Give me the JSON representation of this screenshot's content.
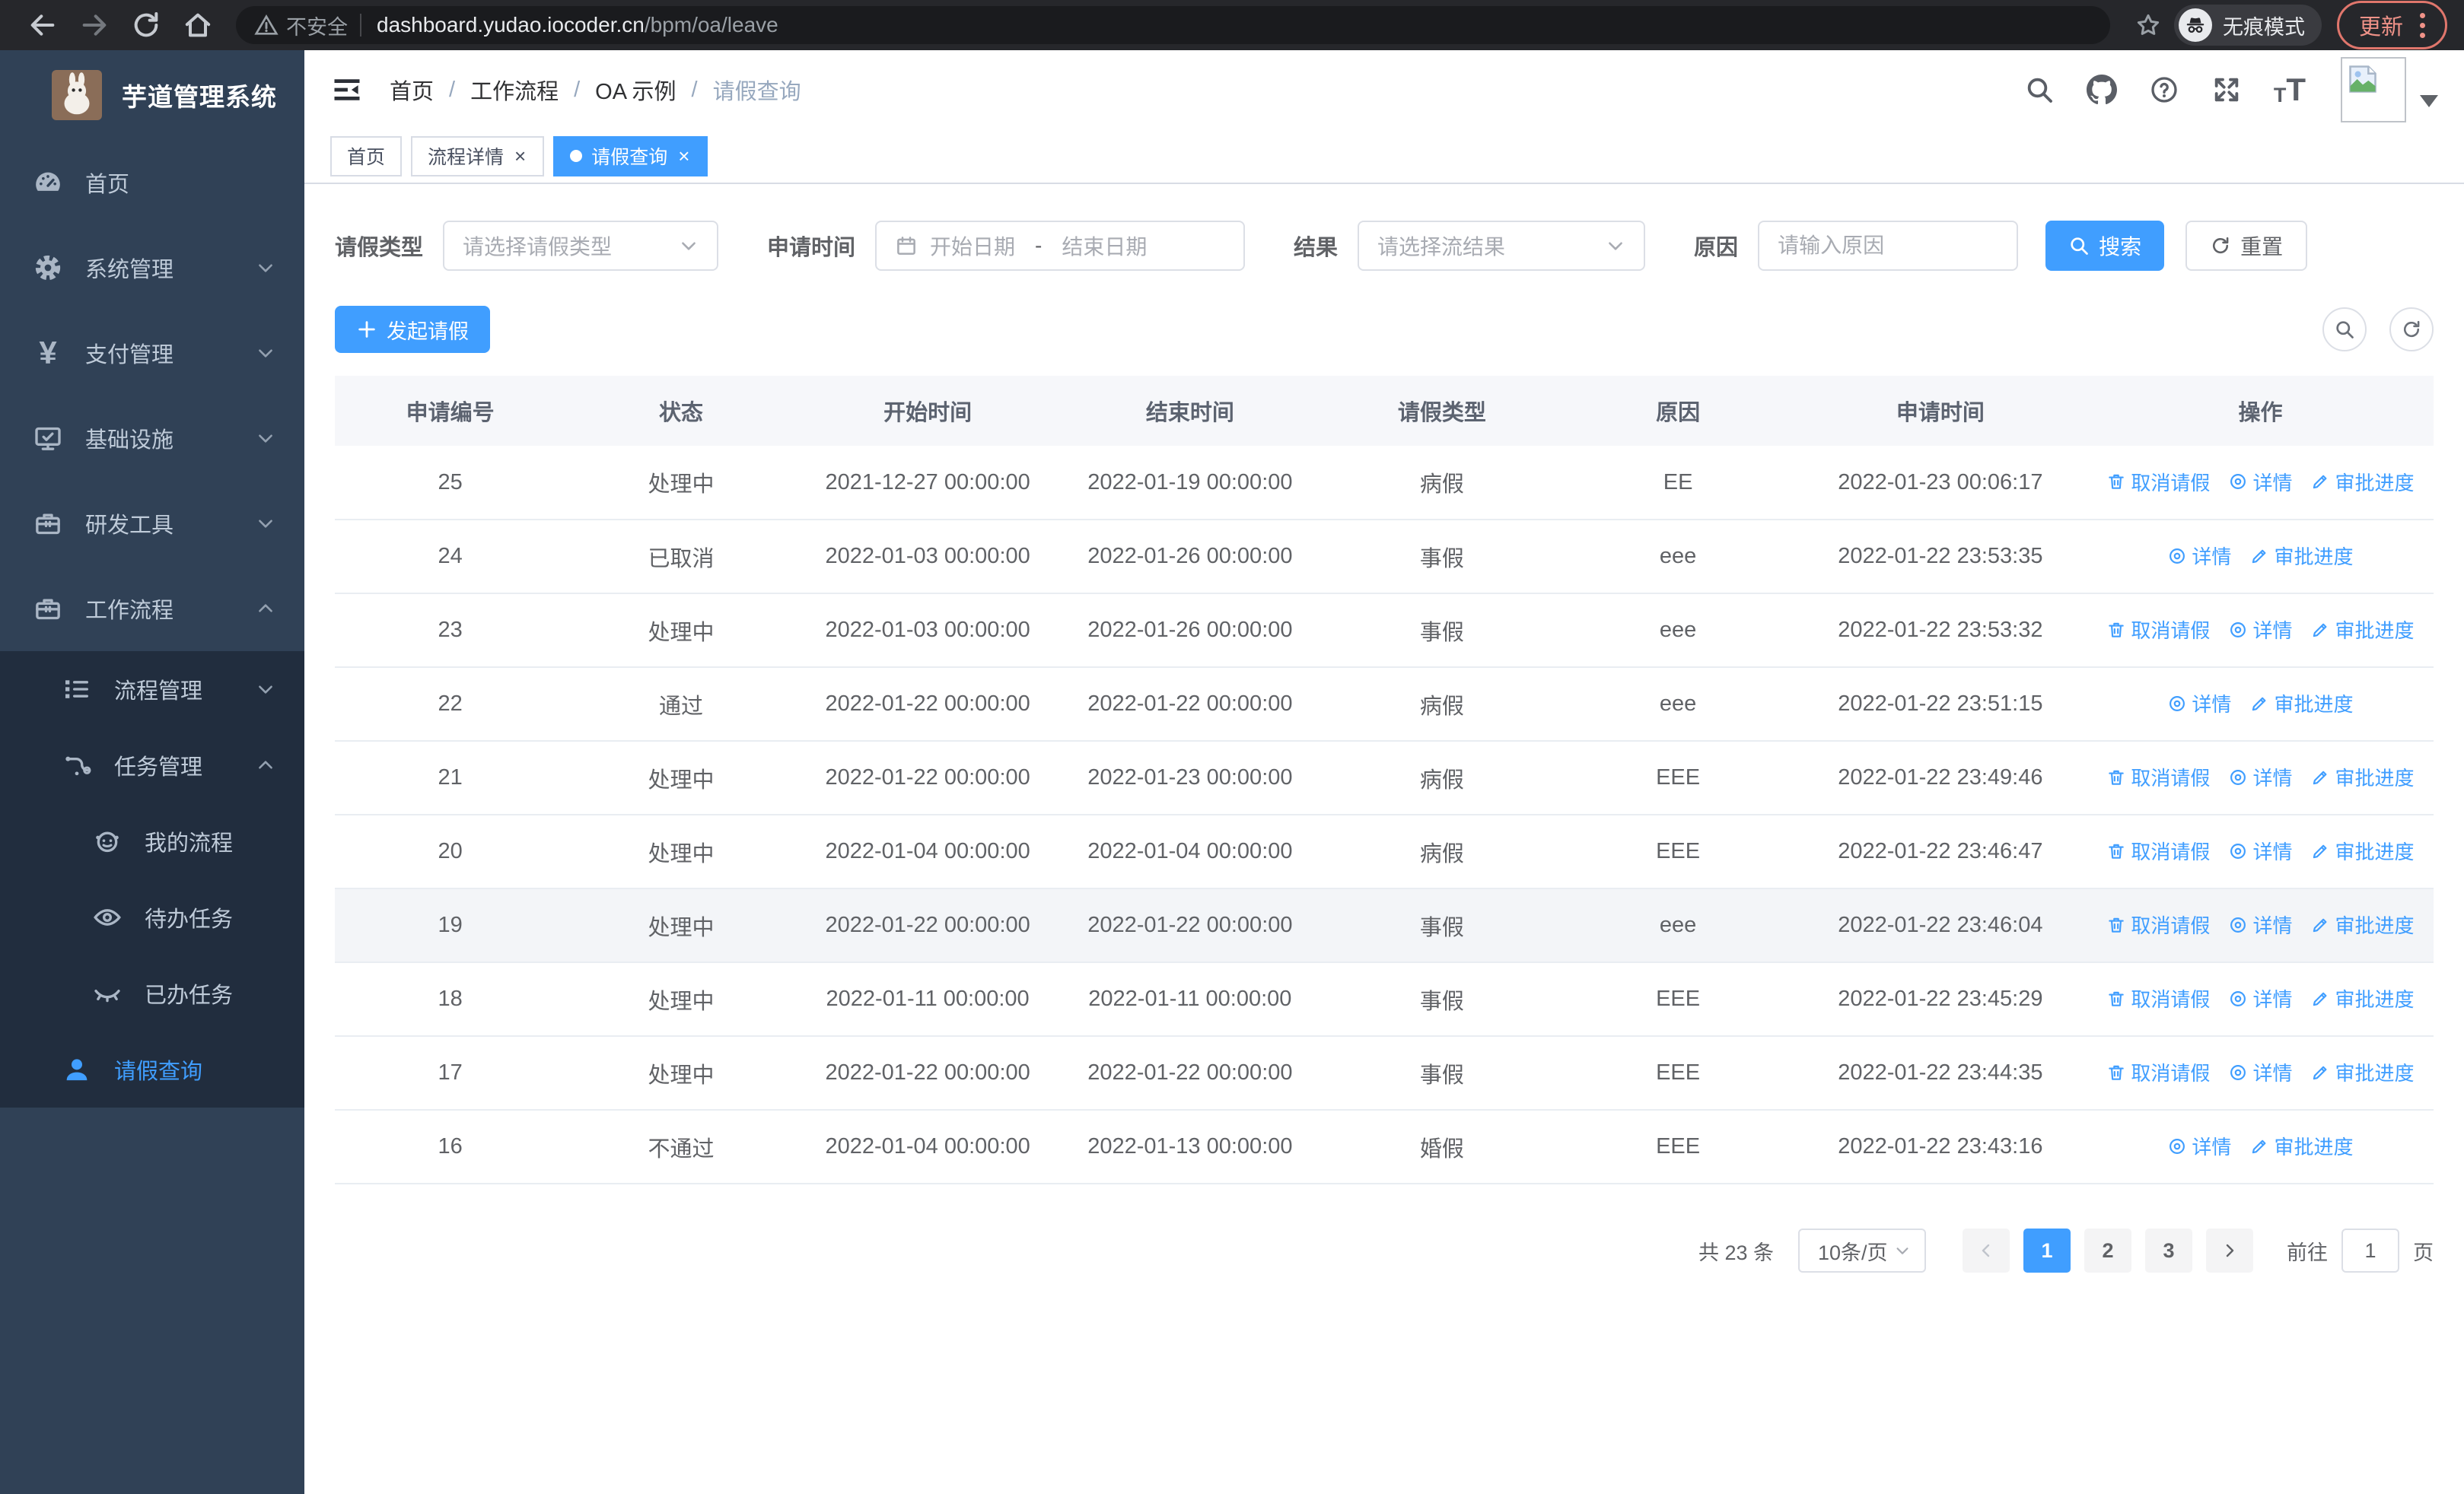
{
  "browser": {
    "security_warning": "不安全",
    "url_host": "dashboard.yudao.iocoder.cn",
    "url_path": "/bpm/oa/leave",
    "incognito_label": "无痕模式",
    "update_label": "更新"
  },
  "sidebar": {
    "title": "芋道管理系统",
    "items": [
      {
        "label": "首页",
        "icon": "dashboard",
        "level": 1,
        "expandable": false,
        "expanded": false,
        "group": false,
        "active": false
      },
      {
        "label": "系统管理",
        "icon": "gear",
        "level": 1,
        "expandable": true,
        "expanded": false,
        "group": false,
        "active": false
      },
      {
        "label": "支付管理",
        "icon": "yen",
        "level": 1,
        "expandable": true,
        "expanded": false,
        "group": false,
        "active": false
      },
      {
        "label": "基础设施",
        "icon": "monitor",
        "level": 1,
        "expandable": true,
        "expanded": false,
        "group": false,
        "active": false
      },
      {
        "label": "研发工具",
        "icon": "toolbox",
        "level": 1,
        "expandable": true,
        "expanded": false,
        "group": false,
        "active": false
      },
      {
        "label": "工作流程",
        "icon": "toolbox",
        "level": 1,
        "expandable": true,
        "expanded": true,
        "group": false,
        "active": false
      },
      {
        "label": "流程管理",
        "icon": "tree",
        "level": 2,
        "expandable": true,
        "expanded": false,
        "group": true,
        "active": false
      },
      {
        "label": "任务管理",
        "icon": "branch",
        "level": 2,
        "expandable": true,
        "expanded": true,
        "group": true,
        "active": false
      },
      {
        "label": "我的流程",
        "icon": "face",
        "level": 3,
        "expandable": false,
        "expanded": false,
        "group": true,
        "active": false
      },
      {
        "label": "待办任务",
        "icon": "eye-open",
        "level": 3,
        "expandable": false,
        "expanded": false,
        "group": true,
        "active": false
      },
      {
        "label": "已办任务",
        "icon": "eye-closed",
        "level": 3,
        "expandable": false,
        "expanded": false,
        "group": true,
        "active": false
      },
      {
        "label": "请假查询",
        "icon": "user",
        "level": 2,
        "expandable": false,
        "expanded": false,
        "group": true,
        "active": true
      }
    ]
  },
  "navbar": {
    "breadcrumb": [
      "首页",
      "工作流程",
      "OA 示例",
      "请假查询"
    ]
  },
  "tabs": [
    {
      "label": "首页",
      "closable": false,
      "active": false
    },
    {
      "label": "流程详情",
      "closable": true,
      "active": false
    },
    {
      "label": "请假查询",
      "closable": true,
      "active": true
    }
  ],
  "filters": {
    "leave_type_label": "请假类型",
    "leave_type_placeholder": "请选择请假类型",
    "apply_time_label": "申请时间",
    "start_date_placeholder": "开始日期",
    "date_separator": "-",
    "end_date_placeholder": "结束日期",
    "result_label": "结果",
    "result_placeholder": "请选择流结果",
    "reason_label": "原因",
    "reason_placeholder": "请输入原因",
    "search_label": "搜索",
    "reset_label": "重置"
  },
  "toolbar": {
    "create_label": "发起请假"
  },
  "table": {
    "columns": [
      "申请编号",
      "状态",
      "开始时间",
      "结束时间",
      "请假类型",
      "原因",
      "申请时间",
      "操作"
    ],
    "action_labels": {
      "cancel": "取消请假",
      "detail": "详情",
      "progress": "审批进度"
    },
    "rows": [
      {
        "id": "25",
        "status": "处理中",
        "start": "2021-12-27 00:00:00",
        "end": "2022-01-19 00:00:00",
        "type": "病假",
        "reason": "EE",
        "applied": "2022-01-23 00:06:17",
        "actions": [
          "cancel",
          "detail",
          "progress"
        ],
        "highlight": false
      },
      {
        "id": "24",
        "status": "已取消",
        "start": "2022-01-03 00:00:00",
        "end": "2022-01-26 00:00:00",
        "type": "事假",
        "reason": "eee",
        "applied": "2022-01-22 23:53:35",
        "actions": [
          "detail",
          "progress"
        ],
        "highlight": false
      },
      {
        "id": "23",
        "status": "处理中",
        "start": "2022-01-03 00:00:00",
        "end": "2022-01-26 00:00:00",
        "type": "事假",
        "reason": "eee",
        "applied": "2022-01-22 23:53:32",
        "actions": [
          "cancel",
          "detail",
          "progress"
        ],
        "highlight": false
      },
      {
        "id": "22",
        "status": "通过",
        "start": "2022-01-22 00:00:00",
        "end": "2022-01-22 00:00:00",
        "type": "病假",
        "reason": "eee",
        "applied": "2022-01-22 23:51:15",
        "actions": [
          "detail",
          "progress"
        ],
        "highlight": false
      },
      {
        "id": "21",
        "status": "处理中",
        "start": "2022-01-22 00:00:00",
        "end": "2022-01-23 00:00:00",
        "type": "病假",
        "reason": "EEE",
        "applied": "2022-01-22 23:49:46",
        "actions": [
          "cancel",
          "detail",
          "progress"
        ],
        "highlight": false
      },
      {
        "id": "20",
        "status": "处理中",
        "start": "2022-01-04 00:00:00",
        "end": "2022-01-04 00:00:00",
        "type": "病假",
        "reason": "EEE",
        "applied": "2022-01-22 23:46:47",
        "actions": [
          "cancel",
          "detail",
          "progress"
        ],
        "highlight": false
      },
      {
        "id": "19",
        "status": "处理中",
        "start": "2022-01-22 00:00:00",
        "end": "2022-01-22 00:00:00",
        "type": "事假",
        "reason": "eee",
        "applied": "2022-01-22 23:46:04",
        "actions": [
          "cancel",
          "detail",
          "progress"
        ],
        "highlight": true
      },
      {
        "id": "18",
        "status": "处理中",
        "start": "2022-01-11 00:00:00",
        "end": "2022-01-11 00:00:00",
        "type": "事假",
        "reason": "EEE",
        "applied": "2022-01-22 23:45:29",
        "actions": [
          "cancel",
          "detail",
          "progress"
        ],
        "highlight": false
      },
      {
        "id": "17",
        "status": "处理中",
        "start": "2022-01-22 00:00:00",
        "end": "2022-01-22 00:00:00",
        "type": "事假",
        "reason": "EEE",
        "applied": "2022-01-22 23:44:35",
        "actions": [
          "cancel",
          "detail",
          "progress"
        ],
        "highlight": false
      },
      {
        "id": "16",
        "status": "不通过",
        "start": "2022-01-04 00:00:00",
        "end": "2022-01-13 00:00:00",
        "type": "婚假",
        "reason": "EEE",
        "applied": "2022-01-22 23:43:16",
        "actions": [
          "detail",
          "progress"
        ],
        "highlight": false
      }
    ]
  },
  "pagination": {
    "total_label": "共 23 条",
    "page_size": "10条/页",
    "pages": [
      "1",
      "2",
      "3"
    ],
    "active_page": "1",
    "goto_label": "前往",
    "goto_value": "1",
    "goto_suffix": "页"
  },
  "colors": {
    "accent": "#409eff",
    "sidebar_bg": "#304156",
    "submenu_bg": "#212d3e"
  }
}
